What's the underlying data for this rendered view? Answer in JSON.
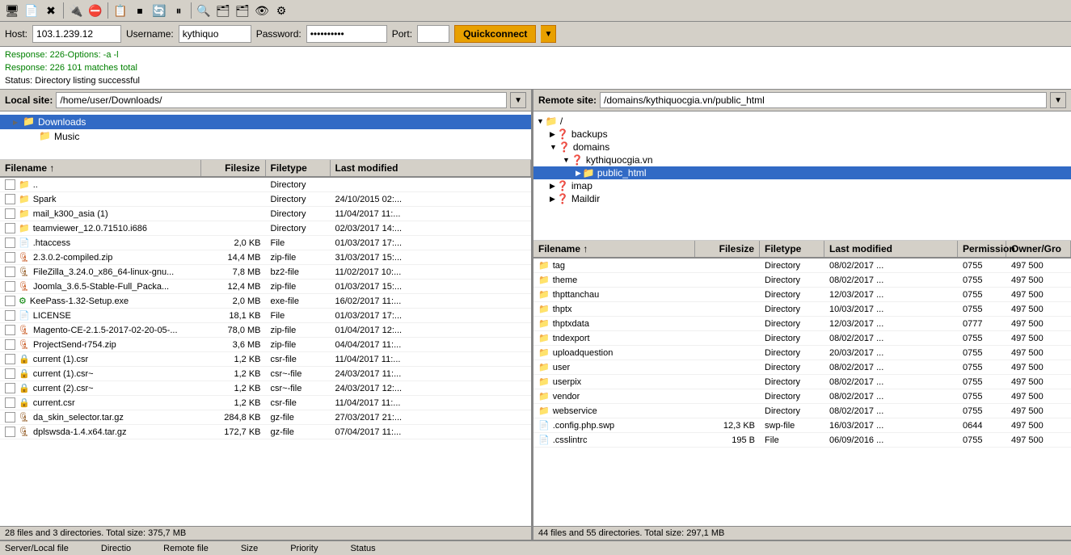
{
  "toolbar": {
    "buttons": [
      {
        "name": "open-site-manager",
        "icon": "🖥"
      },
      {
        "name": "new-tab",
        "icon": "📄"
      },
      {
        "name": "close-tab",
        "icon": "✖"
      },
      {
        "name": "connect",
        "icon": "🔌"
      },
      {
        "name": "disconnect",
        "icon": "⛔"
      },
      {
        "name": "show-log",
        "icon": "📋"
      },
      {
        "name": "cancel-queue",
        "icon": "⏹"
      },
      {
        "name": "reconnect",
        "icon": "🔄"
      },
      {
        "name": "stop-queue",
        "icon": "⏸"
      },
      {
        "name": "file-search",
        "icon": "🔍"
      },
      {
        "name": "dir-compare",
        "icon": "🗂"
      },
      {
        "name": "filter",
        "icon": "🗂"
      },
      {
        "name": "toggle-hidden",
        "icon": "👁"
      },
      {
        "name": "network-config",
        "icon": "⚙"
      }
    ]
  },
  "connection": {
    "host_label": "Host:",
    "host_value": "103.1.239.12",
    "username_label": "Username:",
    "username_value": "kythiquo",
    "password_label": "Password:",
    "password_value": "••••••••••",
    "port_label": "Port:",
    "port_value": "",
    "quickconnect_label": "Quickconnect"
  },
  "status": {
    "line1": "Response:  226-Options: -a -l",
    "line2": "Response:  226 101 matches total",
    "line3": "Status:     Directory listing successful"
  },
  "local_panel": {
    "site_label": "Local site:",
    "site_path": "/home/user/Downloads/",
    "tree": [
      {
        "id": "downloads",
        "label": "Downloads",
        "indent": 16,
        "expanded": true,
        "type": "folder",
        "selected": true
      },
      {
        "id": "music",
        "label": "Music",
        "indent": 36,
        "expanded": false,
        "type": "folder",
        "selected": false
      }
    ],
    "file_headers": [
      "Filename ↑",
      "Filesize",
      "Filetype",
      "Last modified"
    ],
    "files": [
      {
        "checkbox": true,
        "icon": "folder",
        "name": "..",
        "size": "",
        "type": "Directory",
        "modified": ""
      },
      {
        "checkbox": false,
        "icon": "folder",
        "name": "Spark",
        "size": "",
        "type": "Directory",
        "modified": "24/10/2015 02:..."
      },
      {
        "checkbox": false,
        "icon": "folder",
        "name": "mail_k300_asia (1)",
        "size": "",
        "type": "Directory",
        "modified": "11/04/2017 11:..."
      },
      {
        "checkbox": false,
        "icon": "folder",
        "name": "teamviewer_12.0.71510.i686",
        "size": "",
        "type": "Directory",
        "modified": "02/03/2017 14:..."
      },
      {
        "checkbox": false,
        "icon": "file",
        "name": ".htaccess",
        "size": "2,0 KB",
        "type": "File",
        "modified": "01/03/2017 17:..."
      },
      {
        "checkbox": false,
        "icon": "zip",
        "name": "2.3.0.2-compiled.zip",
        "size": "14,4 MB",
        "type": "zip-file",
        "modified": "31/03/2017 15:..."
      },
      {
        "checkbox": false,
        "icon": "bz2",
        "name": "FileZilla_3.24.0_x86_64-linux-gnu...",
        "size": "7,8 MB",
        "type": "bz2-file",
        "modified": "11/02/2017 10:..."
      },
      {
        "checkbox": false,
        "icon": "zip",
        "name": "Joomla_3.6.5-Stable-Full_Packa...",
        "size": "12,4 MB",
        "type": "zip-file",
        "modified": "01/03/2017 15:..."
      },
      {
        "checkbox": false,
        "icon": "exe",
        "name": "KeePass-1.32-Setup.exe",
        "size": "2,0 MB",
        "type": "exe-file",
        "modified": "16/02/2017 11:..."
      },
      {
        "checkbox": false,
        "icon": "file",
        "name": "LICENSE",
        "size": "18,1 KB",
        "type": "File",
        "modified": "01/03/2017 17:..."
      },
      {
        "checkbox": false,
        "icon": "zip",
        "name": "Magento-CE-2.1.5-2017-02-20-05-...",
        "size": "78,0 MB",
        "type": "zip-file",
        "modified": "01/04/2017 12:..."
      },
      {
        "checkbox": false,
        "icon": "zip",
        "name": "ProjectSend-r754.zip",
        "size": "3,6 MB",
        "type": "zip-file",
        "modified": "04/04/2017 11:..."
      },
      {
        "checkbox": false,
        "icon": "csr",
        "name": "current (1).csr",
        "size": "1,2 KB",
        "type": "csr-file",
        "modified": "11/04/2017 11:..."
      },
      {
        "checkbox": false,
        "icon": "csr",
        "name": "current (1).csr~",
        "size": "1,2 KB",
        "type": "csr~-file",
        "modified": "24/03/2017 11:..."
      },
      {
        "checkbox": false,
        "icon": "csr",
        "name": "current (2).csr~",
        "size": "1,2 KB",
        "type": "csr~-file",
        "modified": "24/03/2017 12:..."
      },
      {
        "checkbox": false,
        "icon": "csr",
        "name": "current.csr",
        "size": "1,2 KB",
        "type": "csr-file",
        "modified": "11/04/2017 11:..."
      },
      {
        "checkbox": false,
        "icon": "gz",
        "name": "da_skin_selector.tar.gz",
        "size": "284,8 KB",
        "type": "gz-file",
        "modified": "27/03/2017 21:..."
      },
      {
        "checkbox": false,
        "icon": "gz",
        "name": "dplswsda-1.4.x64.tar.gz",
        "size": "172,7 KB",
        "type": "gz-file",
        "modified": "07/04/2017 11:..."
      }
    ],
    "footer": "28 files and 3 directories. Total size: 375,7 MB"
  },
  "remote_panel": {
    "site_label": "Remote site:",
    "site_path": "/domains/kythiquocgia.vn/public_html",
    "tree": [
      {
        "id": "root",
        "label": "/",
        "indent": 4,
        "expanded": true,
        "type": "folder"
      },
      {
        "id": "backups",
        "label": "backups",
        "indent": 20,
        "expanded": false,
        "type": "folder-q"
      },
      {
        "id": "domains",
        "label": "domains",
        "indent": 20,
        "expanded": true,
        "type": "folder-q"
      },
      {
        "id": "kythiquocgia",
        "label": "kythiquocgia.vn",
        "indent": 36,
        "expanded": true,
        "type": "folder-q"
      },
      {
        "id": "public_html",
        "label": "public_html",
        "indent": 52,
        "expanded": false,
        "type": "folder",
        "selected": true
      },
      {
        "id": "imap",
        "label": "imap",
        "indent": 20,
        "expanded": false,
        "type": "folder-q"
      },
      {
        "id": "maildir",
        "label": "Maildir",
        "indent": 20,
        "expanded": false,
        "type": "folder-q"
      }
    ],
    "file_headers": [
      "Filename ↑",
      "Filesize",
      "Filetype",
      "Last modified",
      "Permission",
      "Owner/Gro"
    ],
    "files": [
      {
        "icon": "folder",
        "name": "tag",
        "size": "",
        "type": "Directory",
        "modified": "08/02/2017 ...",
        "perm": "0755",
        "owner": "497 500"
      },
      {
        "icon": "folder",
        "name": "theme",
        "size": "",
        "type": "Directory",
        "modified": "08/02/2017 ...",
        "perm": "0755",
        "owner": "497 500"
      },
      {
        "icon": "folder",
        "name": "thpttanchau",
        "size": "",
        "type": "Directory",
        "modified": "12/03/2017 ...",
        "perm": "0755",
        "owner": "497 500"
      },
      {
        "icon": "folder",
        "name": "thptx",
        "size": "",
        "type": "Directory",
        "modified": "10/03/2017 ...",
        "perm": "0755",
        "owner": "497 500"
      },
      {
        "icon": "folder",
        "name": "thptxdata",
        "size": "",
        "type": "Directory",
        "modified": "12/03/2017 ...",
        "perm": "0777",
        "owner": "497 500"
      },
      {
        "icon": "folder",
        "name": "tndexport",
        "size": "",
        "type": "Directory",
        "modified": "08/02/2017 ...",
        "perm": "0755",
        "owner": "497 500"
      },
      {
        "icon": "folder",
        "name": "uploadquestion",
        "size": "",
        "type": "Directory",
        "modified": "20/03/2017 ...",
        "perm": "0755",
        "owner": "497 500"
      },
      {
        "icon": "folder",
        "name": "user",
        "size": "",
        "type": "Directory",
        "modified": "08/02/2017 ...",
        "perm": "0755",
        "owner": "497 500"
      },
      {
        "icon": "folder",
        "name": "userpix",
        "size": "",
        "type": "Directory",
        "modified": "08/02/2017 ...",
        "perm": "0755",
        "owner": "497 500"
      },
      {
        "icon": "folder",
        "name": "vendor",
        "size": "",
        "type": "Directory",
        "modified": "08/02/2017 ...",
        "perm": "0755",
        "owner": "497 500"
      },
      {
        "icon": "folder",
        "name": "webservice",
        "size": "",
        "type": "Directory",
        "modified": "08/02/2017 ...",
        "perm": "0755",
        "owner": "497 500"
      },
      {
        "icon": "file",
        "name": ".config.php.swp",
        "size": "12,3 KB",
        "type": "swp-file",
        "modified": "16/03/2017 ...",
        "perm": "0644",
        "owner": "497 500"
      },
      {
        "icon": "file",
        "name": ".csslintrc",
        "size": "195 B",
        "type": "File",
        "modified": "06/09/2016 ...",
        "perm": "0755",
        "owner": "497 500"
      }
    ],
    "footer": "44 files and 55 directories. Total size: 297,1 MB"
  },
  "transfer_bar": {
    "col1": "Server/Local file",
    "col2": "Directio",
    "col3": "Remote file",
    "col4": "Size",
    "col5": "Priority",
    "col6": "Status"
  }
}
